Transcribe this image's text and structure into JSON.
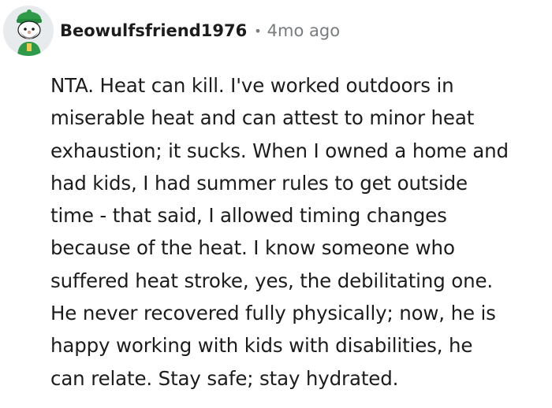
{
  "comment": {
    "avatar_icon": "snoo-avatar-icon",
    "username": "Beowulfsfriend1976",
    "separator": "•",
    "time_ago": "4mo ago",
    "body_lines": [
      "NTA. Heat can kill. I've worked outdoors in",
      "miserable heat and can attest to minor heat",
      "exhaustion; it sucks. When I owned a home and",
      "had kids, I had summer rules to get outside",
      "time - that said, I allowed timing changes",
      "because of the heat. I know someone who",
      "suffered heat stroke, yes, the debilitating one.",
      "He never recovered fully physically; now, he is",
      "happy working with kids with disabilities, he",
      "can relate. Stay safe; stay hydrated."
    ]
  },
  "colors": {
    "text": "#1c1c1c",
    "meta": "#787c7e",
    "avatar_bg": "#e7ebee",
    "avatar_green": "#2e9a4a"
  }
}
